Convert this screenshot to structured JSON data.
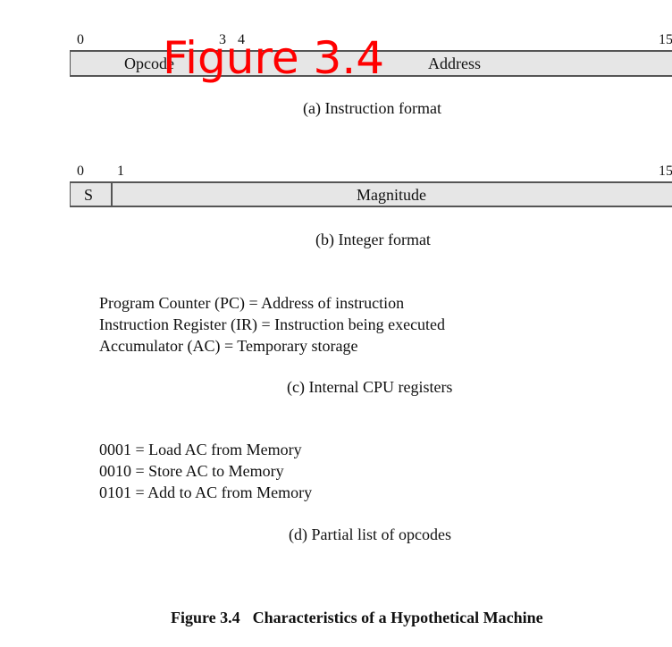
{
  "overlay_label": "Figure 3.4",
  "instruction_format": {
    "bit_labels": [
      "0",
      "3",
      "4",
      "15"
    ],
    "fields": [
      "Opcode",
      "Address"
    ],
    "caption": "(a) Instruction format"
  },
  "integer_format": {
    "bit_labels": [
      "0",
      "1",
      "15"
    ],
    "fields": [
      "S",
      "Magnitude"
    ],
    "caption": "(b) Integer format"
  },
  "registers": {
    "lines": [
      "Program Counter (PC) = Address of instruction",
      "Instruction Register (IR) = Instruction being executed",
      "Accumulator (AC) = Temporary storage"
    ],
    "caption": "(c) Internal CPU registers"
  },
  "opcodes": {
    "lines": [
      "0001 = Load AC from Memory",
      "0010 = Store AC to Memory",
      "0101 = Add to AC from Memory"
    ],
    "caption": "(d) Partial list of opcodes"
  },
  "figure_title": {
    "number": "Figure 3.4",
    "text": "Characteristics of a Hypothetical Machine"
  }
}
